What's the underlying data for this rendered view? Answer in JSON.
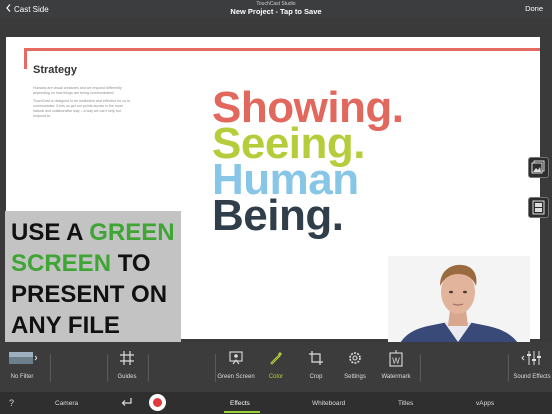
{
  "topbar": {
    "back_label": "Cast Side",
    "app_name": "TouchCast Studio",
    "project_title": "New Project - Tap to Save",
    "done_label": "Done"
  },
  "slide": {
    "heading": "Strategy",
    "paragraphs": [
      "Humans are visual creatures and we respond differently depending on how things are being communicated.",
      "TouchCast is designed to be instinctive and effective for us to communicate. It lets us get our points across in the most natural and collaborative way – a way we can't help but respond to."
    ],
    "words": [
      "Showing.",
      "Seeing.",
      "Human",
      "Being."
    ]
  },
  "overlay": {
    "line1_a": "USE A ",
    "line1_b": "GREEN",
    "line2_a": "SCREEN",
    "line2_b": " TO",
    "line3": "PRESENT ON",
    "line4": "ANY FILE"
  },
  "toolbar": {
    "filter_label": "No Filter",
    "guides_label": "Guides",
    "green_screen_label": "Green Screen",
    "color_label": "Color",
    "crop_label": "Crop",
    "settings_label": "Settings",
    "watermark_label": "Watermark",
    "sound_effects_label": "Sound Effects",
    "watermark_glyph": "W"
  },
  "bottombar": {
    "help_label": "?",
    "camera_label": "Camera",
    "effects_label": "Effects",
    "whiteboard_label": "Whiteboard",
    "titles_label": "Titles",
    "vapps_label": "vApps"
  },
  "colors": {
    "accent_red": "#e2675d",
    "accent_green": "#b6cd3b",
    "accent_blue": "#87c6e6",
    "dark_word": "#2f3e48",
    "overlay_green": "#3fa535",
    "record_red": "#e23a3a"
  }
}
